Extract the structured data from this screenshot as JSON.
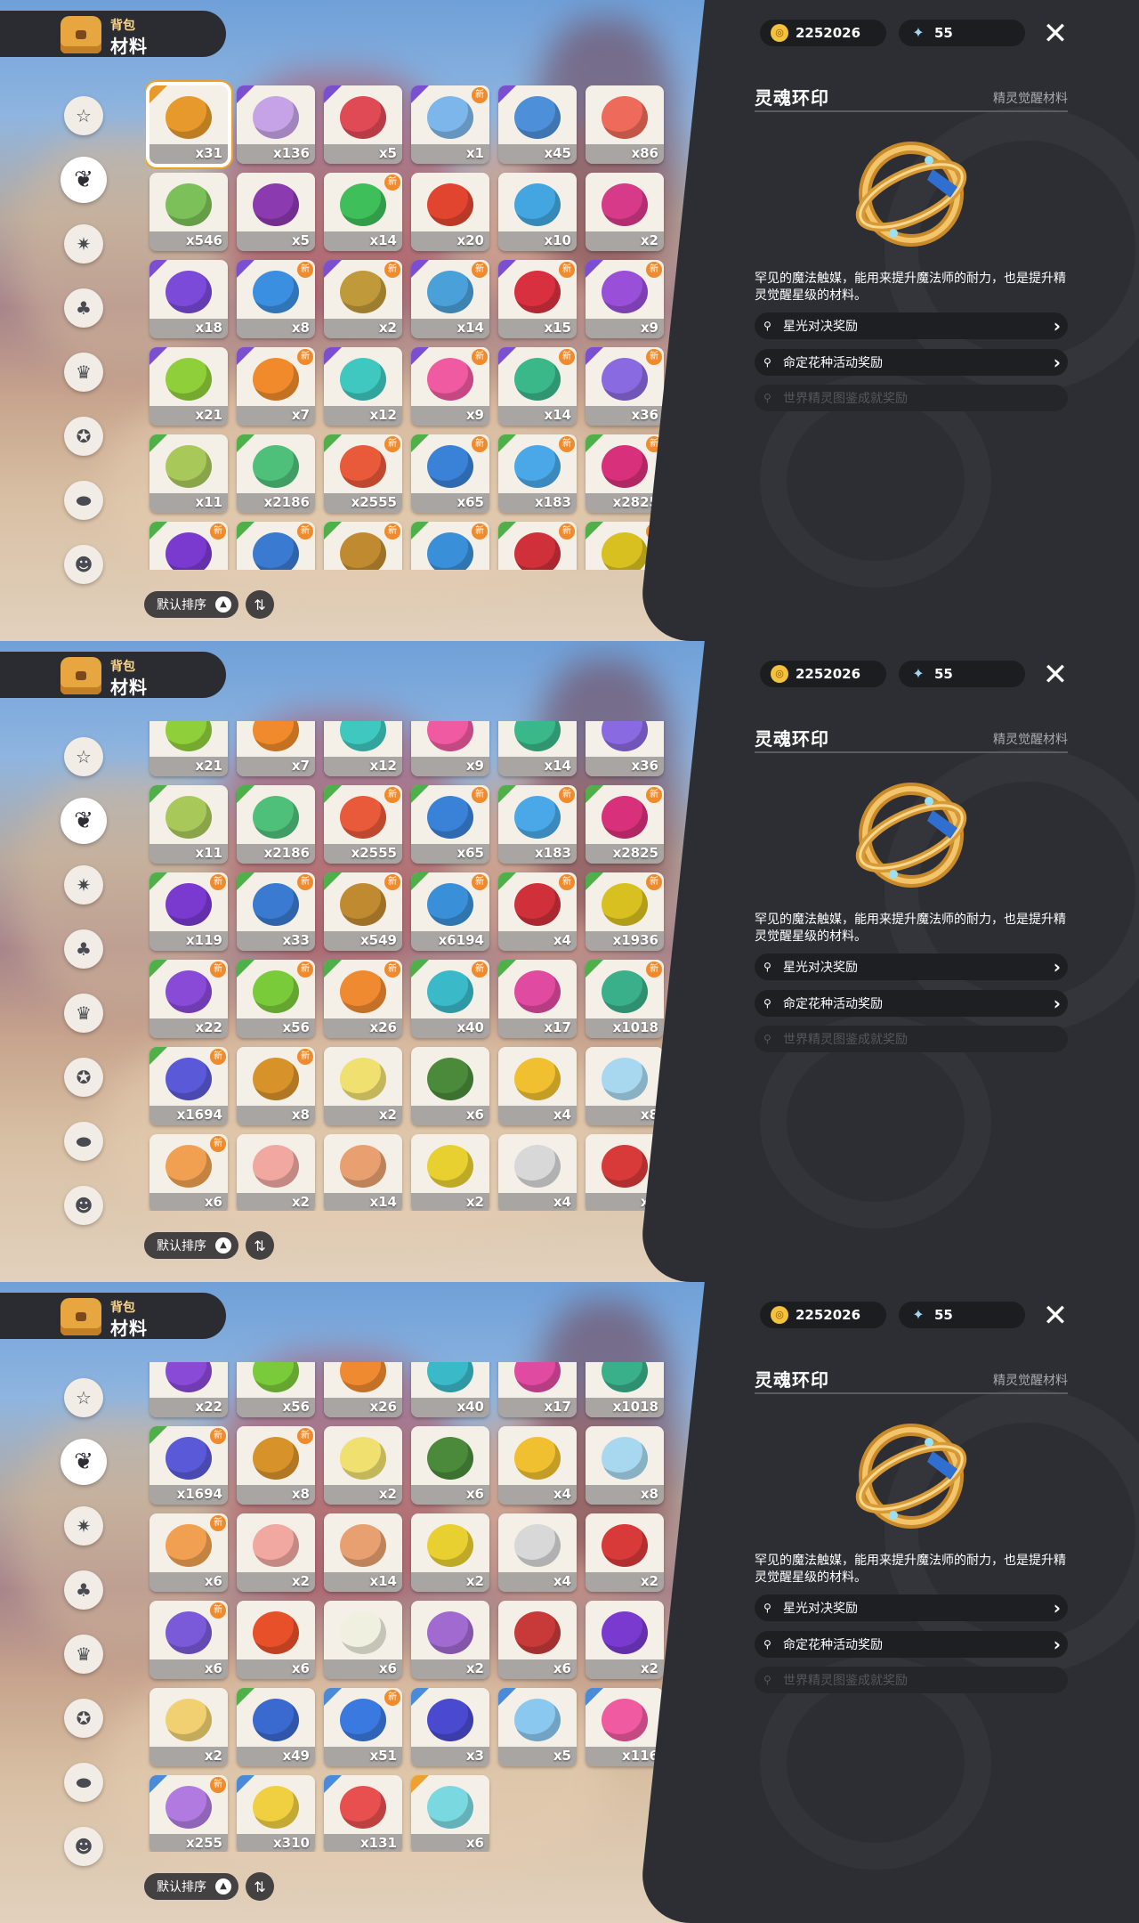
{
  "header": {
    "title_small": "背包",
    "title_big": "材料"
  },
  "nav_icons": [
    "star-badge-icon",
    "leaf-icon",
    "spark-icon",
    "sprout-icon",
    "crown-card-icon",
    "gem-ball-icon",
    "acorn-icon",
    "chest-face-icon"
  ],
  "currency": {
    "coins": "2252026",
    "gems": "55"
  },
  "sort": {
    "label": "默认排序"
  },
  "detail": {
    "title": "灵魂环印",
    "category": "精灵觉醒材料",
    "description": "罕见的魔法触媒，能用来提升魔法师的耐力，也是提升精灵觉醒星级的材料。",
    "sources": [
      {
        "label": "星光对决奖励",
        "enabled": true
      },
      {
        "label": "命定花种活动奖励",
        "enabled": true
      },
      {
        "label": "世界精灵图鉴成就奖励",
        "enabled": false
      }
    ]
  },
  "frames": [
    {
      "scroll_rows": 0,
      "selected": 0
    },
    {
      "scroll_rows": 3,
      "selected": -1
    },
    {
      "scroll_rows": 6,
      "selected": -1
    }
  ],
  "items": [
    {
      "count": "x31",
      "color": "#e79a2b",
      "corner": "#e79a2b",
      "new": false
    },
    {
      "count": "x136",
      "color": "#c6a3e6",
      "corner": "#7a4fd0",
      "new": false
    },
    {
      "count": "x5",
      "color": "#e04a55",
      "corner": "#7a4fd0",
      "new": false
    },
    {
      "count": "x1",
      "color": "#7db6ea",
      "corner": "#7a4fd0",
      "new": true
    },
    {
      "count": "x45",
      "color": "#4d8fd8",
      "corner": "#7a4fd0",
      "new": false
    },
    {
      "count": "x86",
      "color": "#ee6a5a",
      "corner": "",
      "new": false
    },
    {
      "count": "x546",
      "color": "#7cc05a",
      "corner": "",
      "new": false
    },
    {
      "count": "x5",
      "color": "#8c3ab0",
      "corner": "",
      "new": false
    },
    {
      "count": "x14",
      "color": "#3fbf5a",
      "corner": "",
      "new": true
    },
    {
      "count": "x20",
      "color": "#e2452f",
      "corner": "",
      "new": false
    },
    {
      "count": "x10",
      "color": "#43a6e0",
      "corner": "",
      "new": false
    },
    {
      "count": "x2",
      "color": "#d83a8a",
      "corner": "",
      "new": false
    },
    {
      "count": "x18",
      "color": "#7b4ad8",
      "corner": "#7a4fd0",
      "new": false
    },
    {
      "count": "x8",
      "color": "#3a8fe0",
      "corner": "#7a4fd0",
      "new": true
    },
    {
      "count": "x2",
      "color": "#c09a3a",
      "corner": "#7a4fd0",
      "new": true
    },
    {
      "count": "x14",
      "color": "#4aa0d8",
      "corner": "#7a4fd0",
      "new": true
    },
    {
      "count": "x15",
      "color": "#d8303f",
      "corner": "#7a4fd0",
      "new": true
    },
    {
      "count": "x9",
      "color": "#9a4fd8",
      "corner": "#7a4fd0",
      "new": true
    },
    {
      "count": "x21",
      "color": "#8fcf3a",
      "corner": "#7a4fd0",
      "new": false
    },
    {
      "count": "x7",
      "color": "#f08a2a",
      "corner": "#7a4fd0",
      "new": true
    },
    {
      "count": "x12",
      "color": "#3ec8c0",
      "corner": "#7a4fd0",
      "new": false
    },
    {
      "count": "x9",
      "color": "#ef5aa0",
      "corner": "#7a4fd0",
      "new": true
    },
    {
      "count": "x14",
      "color": "#3ab88a",
      "corner": "#7a4fd0",
      "new": true
    },
    {
      "count": "x36",
      "color": "#8a6ae0",
      "corner": "#7a4fd0",
      "new": true
    },
    {
      "count": "x11",
      "color": "#a8c85a",
      "corner": "#4fb04a",
      "new": false
    },
    {
      "count": "x2186",
      "color": "#4fc07a",
      "corner": "#4fb04a",
      "new": false
    },
    {
      "count": "x2555",
      "color": "#e85a3a",
      "corner": "#4fb04a",
      "new": true
    },
    {
      "count": "x65",
      "color": "#3a82d8",
      "corner": "#4fb04a",
      "new": true
    },
    {
      "count": "x183",
      "color": "#4aa8e8",
      "corner": "#4fb04a",
      "new": true
    },
    {
      "count": "x2825",
      "color": "#d8307a",
      "corner": "#4fb04a",
      "new": true
    },
    {
      "count": "x119",
      "color": "#7a3ad0",
      "corner": "#4fb04a",
      "new": true
    },
    {
      "count": "x33",
      "color": "#3a7ad0",
      "corner": "#4fb04a",
      "new": true
    },
    {
      "count": "x549",
      "color": "#c08a30",
      "corner": "#4fb04a",
      "new": true
    },
    {
      "count": "x6194",
      "color": "#3a90d8",
      "corner": "#4fb04a",
      "new": true
    },
    {
      "count": "x4",
      "color": "#d0303a",
      "corner": "#4fb04a",
      "new": true
    },
    {
      "count": "x1936",
      "color": "#d8c020",
      "corner": "#4fb04a",
      "new": true
    },
    {
      "count": "x22",
      "color": "#8a4ad8",
      "corner": "#4fb04a",
      "new": true
    },
    {
      "count": "x56",
      "color": "#7acb3a",
      "corner": "#4fb04a",
      "new": true
    },
    {
      "count": "x26",
      "color": "#f08a30",
      "corner": "#4fb04a",
      "new": true
    },
    {
      "count": "x40",
      "color": "#3abac8",
      "corner": "#4fb04a",
      "new": true
    },
    {
      "count": "x17",
      "color": "#e04aa0",
      "corner": "#4fb04a",
      "new": false
    },
    {
      "count": "x1018",
      "color": "#3ab08a",
      "corner": "#4fb04a",
      "new": true
    },
    {
      "count": "x1694",
      "color": "#5a5ad8",
      "corner": "#4fb04a",
      "new": true
    },
    {
      "count": "x8",
      "color": "#d8922a",
      "corner": "",
      "new": true
    },
    {
      "count": "x2",
      "color": "#f0e070",
      "corner": "",
      "new": false
    },
    {
      "count": "x6",
      "color": "#4a8a3a",
      "corner": "",
      "new": false
    },
    {
      "count": "x4",
      "color": "#f0c030",
      "corner": "",
      "new": false
    },
    {
      "count": "x8",
      "color": "#a8d8f0",
      "corner": "",
      "new": false
    },
    {
      "count": "x6",
      "color": "#f0a050",
      "corner": "",
      "new": true
    },
    {
      "count": "x2",
      "color": "#f0a8a0",
      "corner": "",
      "new": false
    },
    {
      "count": "x14",
      "color": "#e8a070",
      "corner": "",
      "new": false
    },
    {
      "count": "x2",
      "color": "#e8d030",
      "corner": "",
      "new": false
    },
    {
      "count": "x4",
      "color": "#d8d8d8",
      "corner": "",
      "new": false
    },
    {
      "count": "x2",
      "color": "#d83a3a",
      "corner": "",
      "new": false
    },
    {
      "count": "x6",
      "color": "#7a5ad8",
      "corner": "",
      "new": true
    },
    {
      "count": "x6",
      "color": "#e8502a",
      "corner": "",
      "new": false
    },
    {
      "count": "x6",
      "color": "#f0f0e0",
      "corner": "",
      "new": false
    },
    {
      "count": "x2",
      "color": "#a06ad0",
      "corner": "",
      "new": false
    },
    {
      "count": "x6",
      "color": "#c83a3a",
      "corner": "",
      "new": false
    },
    {
      "count": "x2",
      "color": "#7a3ad0",
      "corner": "",
      "new": false
    },
    {
      "count": "x2",
      "color": "#f0d070",
      "corner": "",
      "new": false
    },
    {
      "count": "x49",
      "color": "#3a6ad0",
      "corner": "#4fb04a",
      "new": false
    },
    {
      "count": "x51",
      "color": "#3a7ae0",
      "corner": "#4a8ad8",
      "new": true
    },
    {
      "count": "x3",
      "color": "#4a4ad0",
      "corner": "#4a8ad8",
      "new": false
    },
    {
      "count": "x5",
      "color": "#8ac8f0",
      "corner": "#4a8ad8",
      "new": false
    },
    {
      "count": "x116",
      "color": "#f05aa0",
      "corner": "#4a8ad8",
      "new": false
    },
    {
      "count": "x255",
      "color": "#b07ae0",
      "corner": "#4a8ad8",
      "new": true
    },
    {
      "count": "x310",
      "color": "#f0d040",
      "corner": "#4a8ad8",
      "new": false
    },
    {
      "count": "x131",
      "color": "#e85050",
      "corner": "#4a8ad8",
      "new": false
    },
    {
      "count": "x6",
      "color": "#7ad8e0",
      "corner": "#f0a030",
      "new": false
    }
  ]
}
